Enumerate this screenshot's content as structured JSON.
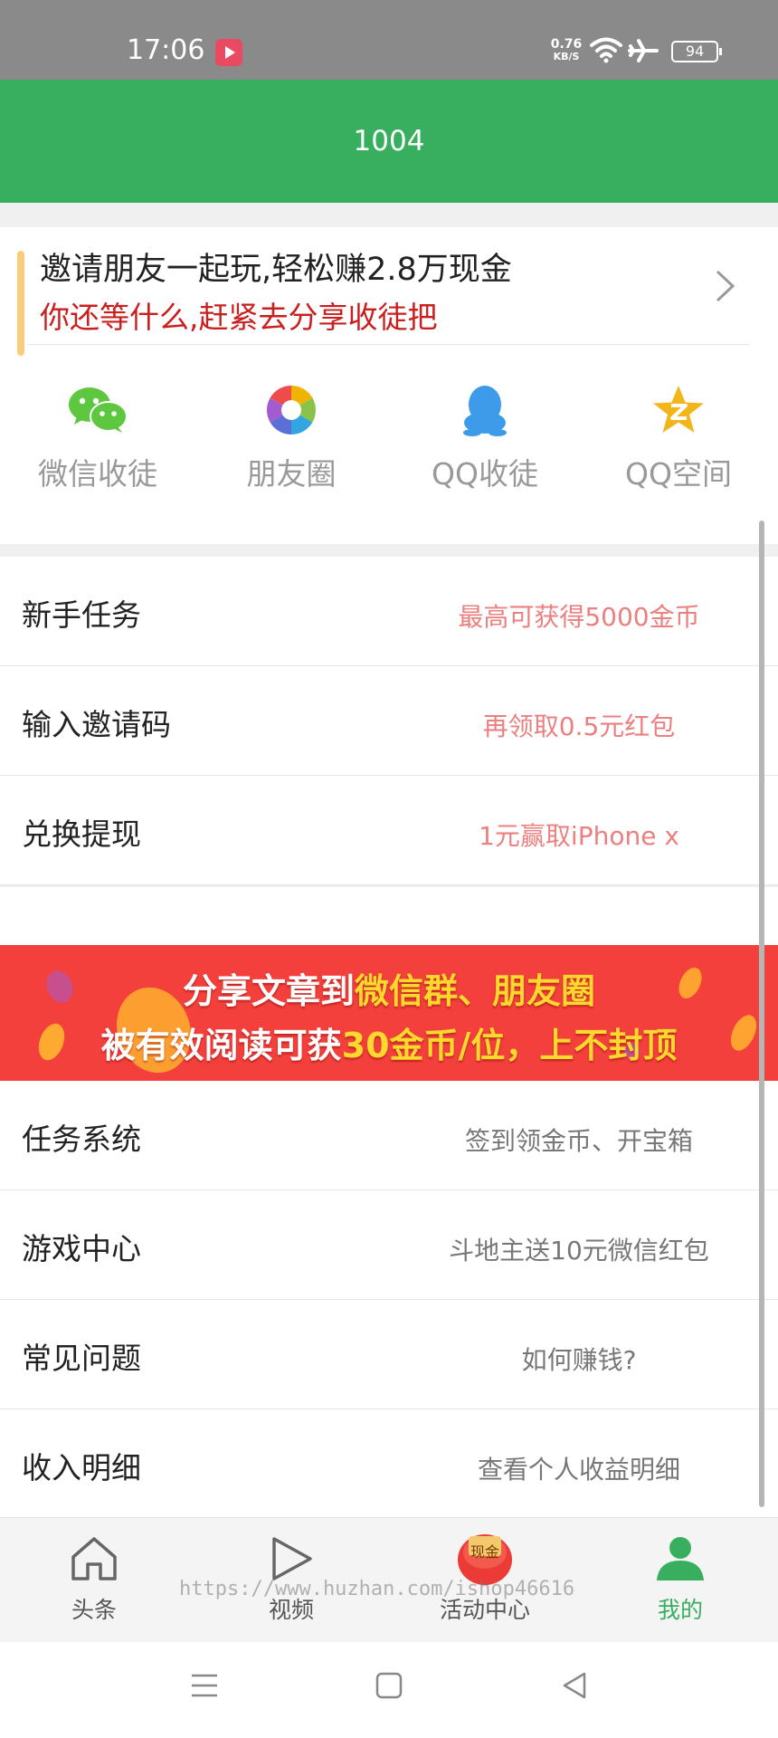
{
  "status_bar": {
    "time": "17:06",
    "speed_value": "0.76",
    "speed_unit": "KB/S",
    "battery": "94",
    "icons": [
      "video-app-icon",
      "wifi-icon",
      "airplane-icon",
      "battery-icon"
    ]
  },
  "header": {
    "title": "1004"
  },
  "invite": {
    "title": "邀请朋友一起玩,轻松赚2.8万现金",
    "subtitle": "你还等什么,赶紧去分享收徒把"
  },
  "share_options": [
    {
      "label": "微信收徒",
      "icon": "wechat-icon"
    },
    {
      "label": "朋友圈",
      "icon": "moments-icon"
    },
    {
      "label": "QQ收徒",
      "icon": "qq-icon"
    },
    {
      "label": "QQ空间",
      "icon": "qzone-icon"
    }
  ],
  "menu_top": [
    {
      "label": "新手任务",
      "value": "最高可获得5000金币"
    },
    {
      "label": "输入邀请码",
      "value": "再领取0.5元红包"
    },
    {
      "label": "兑换提现",
      "value": "1元赢取iPhone x"
    }
  ],
  "promo_banner": {
    "line1_prefix": "分享文章到",
    "line1_highlight": "微信群、朋友圈",
    "line2_prefix": "被有效阅读可获",
    "line2_highlight": "30金币/位，上不封顶"
  },
  "menu_bottom": [
    {
      "label": "任务系统",
      "value": "签到领金币、开宝箱"
    },
    {
      "label": "游戏中心",
      "value": "斗地主送10元微信红包"
    },
    {
      "label": "常见问题",
      "value": "如何赚钱?"
    },
    {
      "label": "收入明细",
      "value": "查看个人收益明细"
    }
  ],
  "tabs": [
    {
      "label": "头条",
      "icon": "home-icon"
    },
    {
      "label": "视频",
      "icon": "play-icon"
    },
    {
      "label": "活动中心",
      "icon": "red-envelope-icon",
      "badge": "现金"
    },
    {
      "label": "我的",
      "icon": "user-icon"
    }
  ],
  "watermark": "https://www.huzhan.com/ishop46616",
  "colors": {
    "brand_green": "#37af5f",
    "promo_red": "#f4403c",
    "promo_highlight": "#ffd82e",
    "value_pink": "#ec7f7f",
    "subtitle_red": "#c9201f"
  }
}
